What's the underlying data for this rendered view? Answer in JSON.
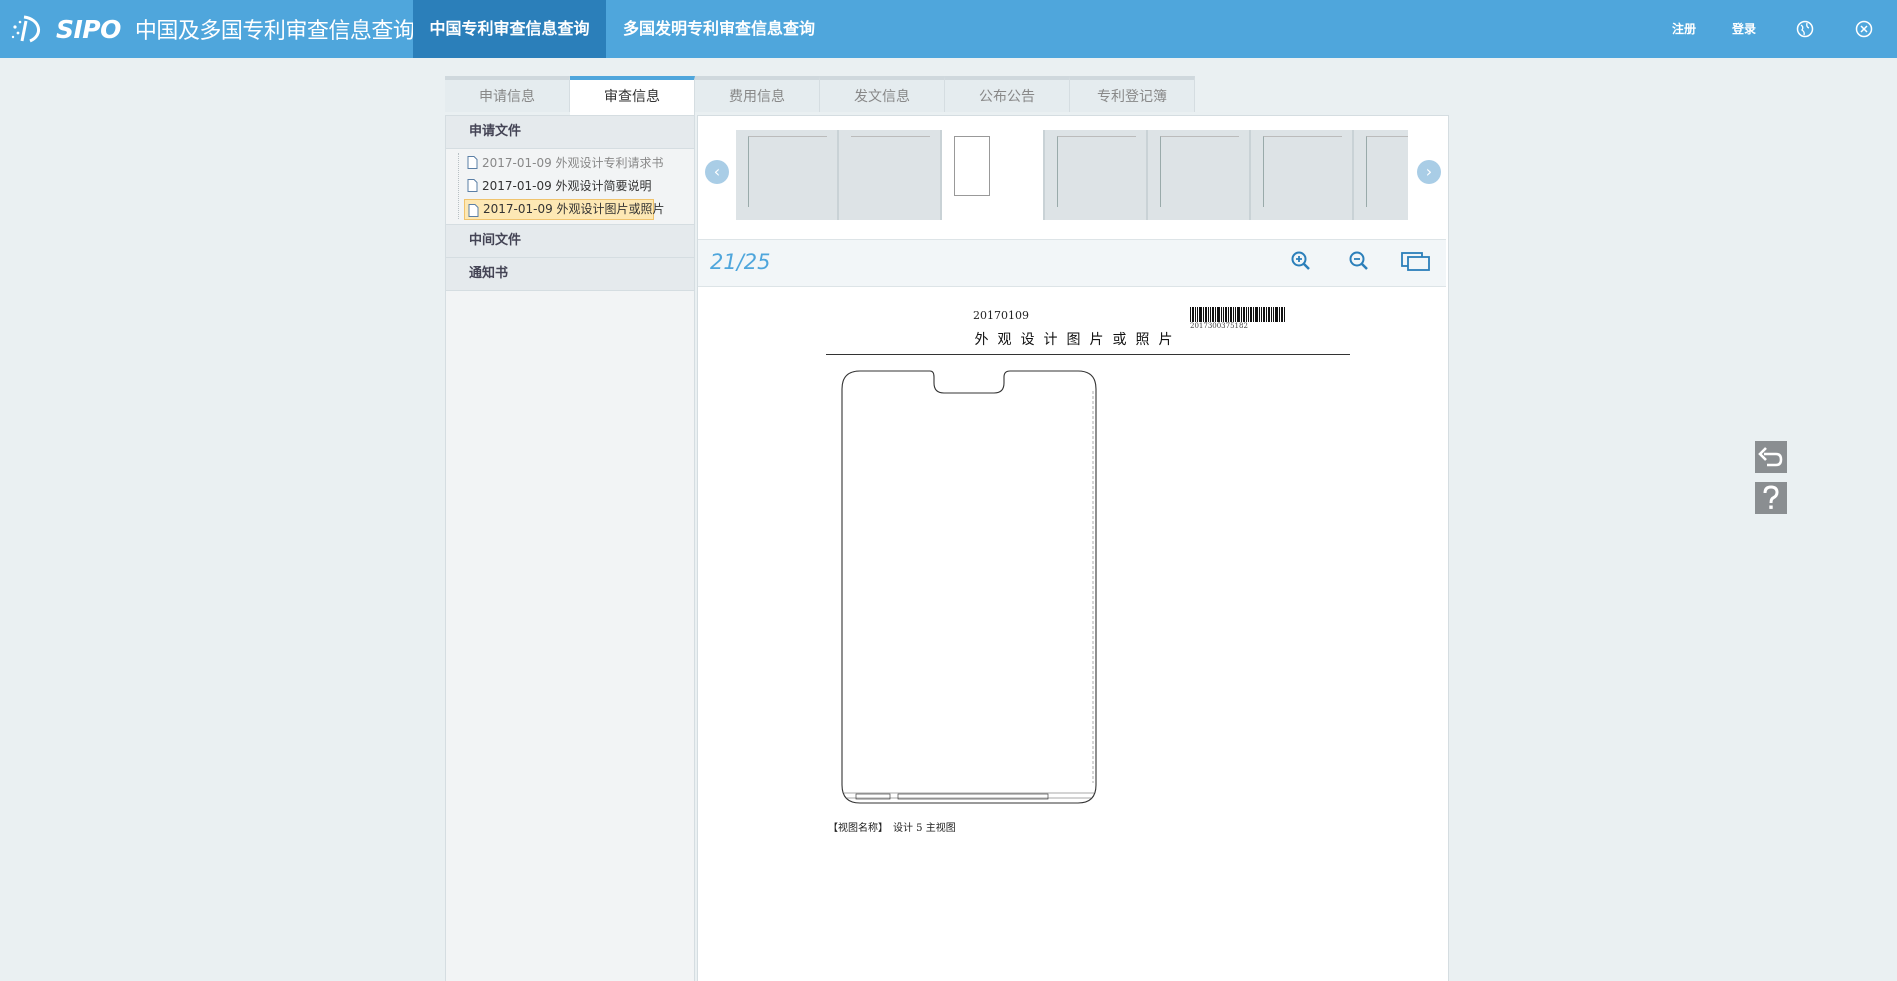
{
  "header": {
    "logo_brand": "SIPO",
    "logo_title": "中国及多国专利审查信息查询",
    "nav": [
      {
        "label": "中国专利审查信息查询",
        "active": true
      },
      {
        "label": "多国发明专利审查信息查询",
        "active": false
      }
    ],
    "register_label": "注册",
    "login_label": "登录",
    "icons": [
      "globe-icon",
      "close-icon"
    ]
  },
  "tabs": [
    {
      "label": "申请信息",
      "active": false
    },
    {
      "label": "审查信息",
      "active": true
    },
    {
      "label": "费用信息",
      "active": false
    },
    {
      "label": "发文信息",
      "active": false
    },
    {
      "label": "公布公告",
      "active": false
    },
    {
      "label": "专利登记簿",
      "active": false
    }
  ],
  "sidebar": {
    "sections": [
      {
        "title": "申请文件",
        "items": [
          {
            "label": "2017-01-09 外观设计专利请求书",
            "state": "visited"
          },
          {
            "label": "2017-01-09 外观设计简要说明",
            "state": "normal"
          },
          {
            "label": "2017-01-09 外观设计图片或照片",
            "state": "selected"
          }
        ]
      },
      {
        "title": "中间文件",
        "items": []
      },
      {
        "title": "通知书",
        "items": []
      }
    ]
  },
  "viewer": {
    "page_indicator": "21/25",
    "tools": [
      "zoom-in-icon",
      "zoom-out-icon",
      "fit-window-icon"
    ],
    "document": {
      "date": "20170109",
      "barcode_number": "2017300375182",
      "title": "外观设计图片或照片",
      "caption": "【视图名称】　设计 5  主视图"
    }
  },
  "side_buttons": [
    "back-icon",
    "help-icon"
  ],
  "colors": {
    "header_bg": "#4fa6dc",
    "nav_active_bg": "#2b7fba",
    "page_bg": "#eaf0f2",
    "accent": "#4fa6dc",
    "selected_item_bg": "#fde8b4"
  }
}
